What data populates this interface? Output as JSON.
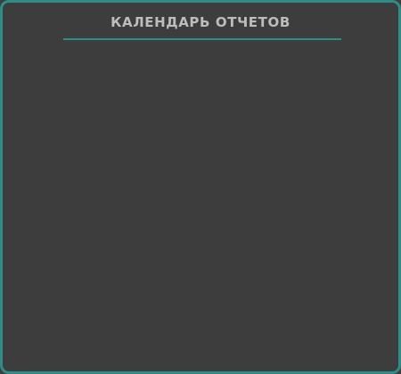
{
  "panel": {
    "title": "КАЛЕНДАРЬ ОТЧЕТОВ",
    "border_color": "#2f8c86",
    "background_color": "#3d3d3d",
    "title_color": "#bdbdbd"
  }
}
